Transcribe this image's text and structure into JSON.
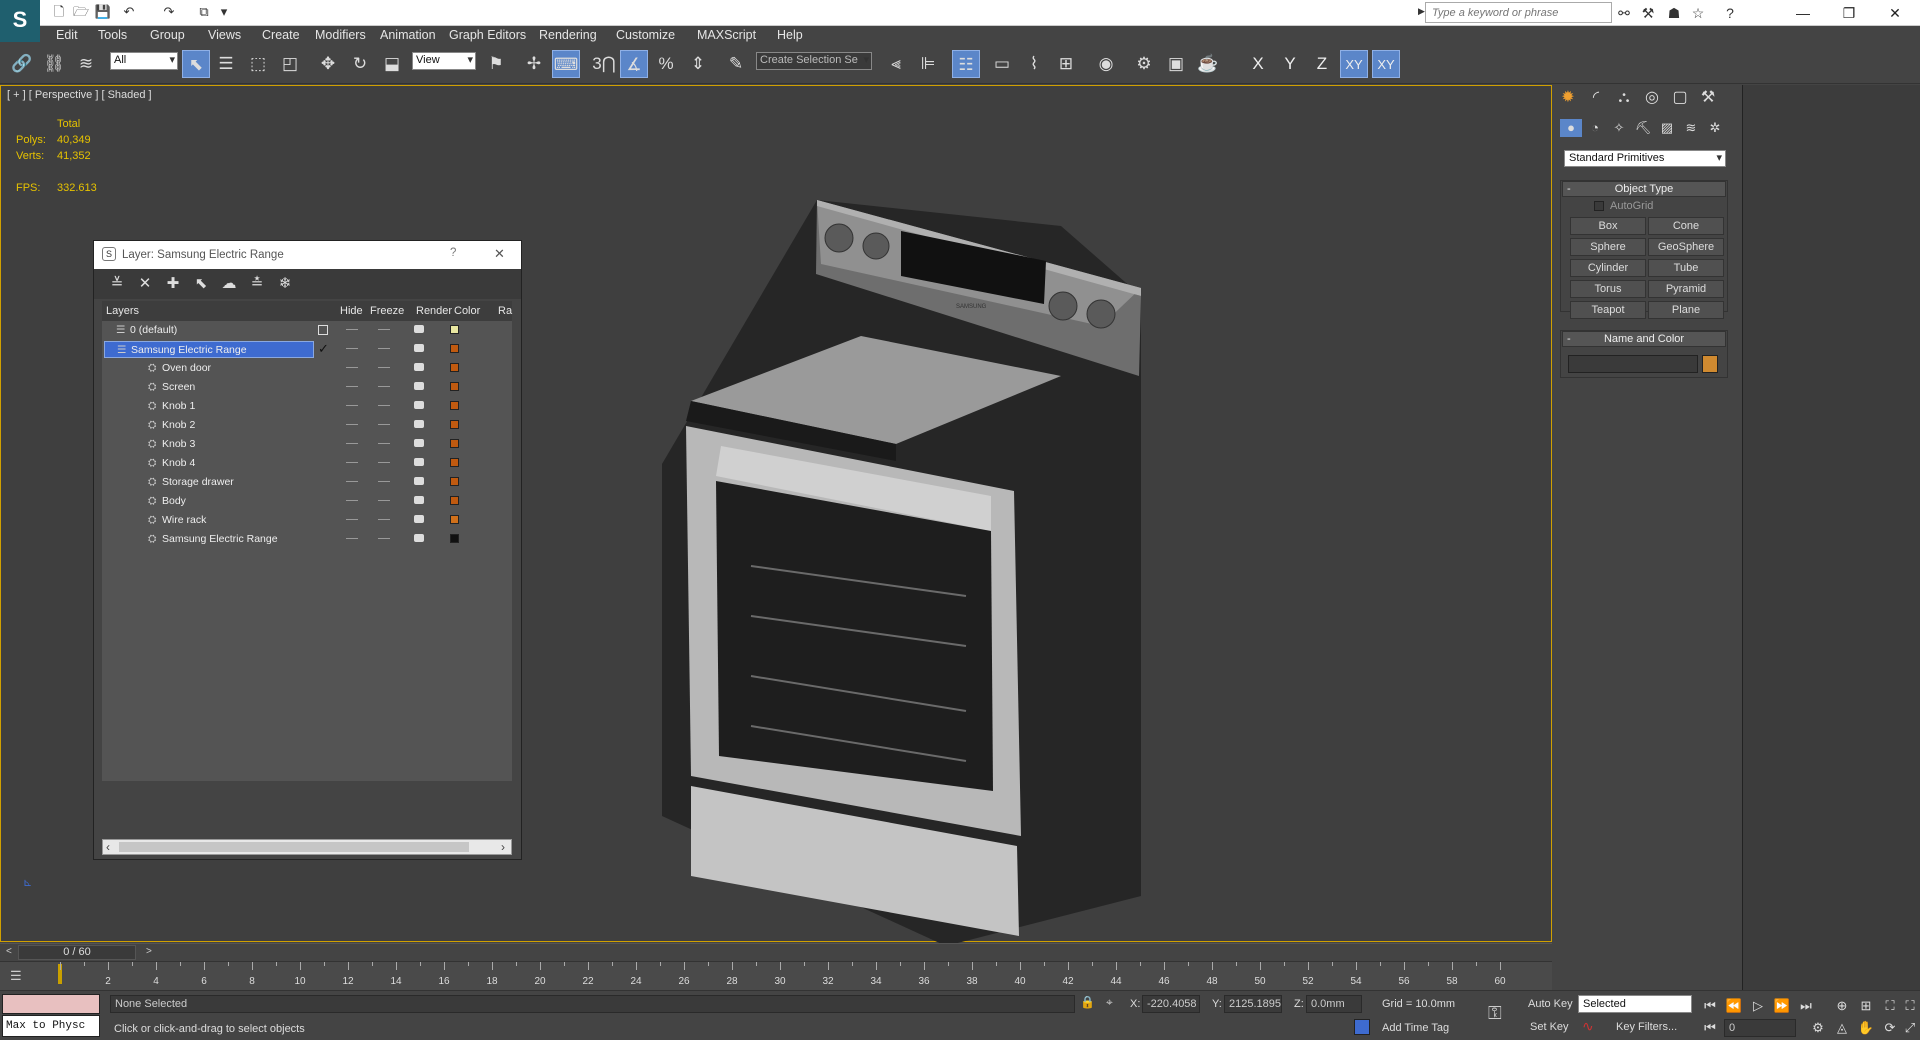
{
  "app": {
    "logo_letter": "S"
  },
  "search": {
    "placeholder": "Type a keyword or phrase"
  },
  "menu": [
    "Edit",
    "Tools",
    "Group",
    "Views",
    "Create",
    "Modifiers",
    "Animation",
    "Graph Editors",
    "Rendering",
    "Customize",
    "MAXScript",
    "Help"
  ],
  "toolbar": {
    "selection_filter": "All",
    "ref_coord": "View",
    "snap_num": "3",
    "selection_set": "Create Selection Se",
    "axis_x": "X",
    "axis_y": "Y",
    "axis_z": "Z",
    "axis_xy": "XY",
    "axis_xy2": "XY"
  },
  "viewport": {
    "label": "[ + ] [ Perspective ] [ Shaded ]",
    "stats": {
      "total_label": "Total",
      "polys_label": "Polys:",
      "polys": "40,349",
      "verts_label": "Verts:",
      "verts": "41,352",
      "fps_label": "FPS:",
      "fps": "332.613"
    },
    "brand": "SAMSUNG"
  },
  "layer_window": {
    "title": "Layer: Samsung Electric Range",
    "help": "?",
    "close": "✕",
    "columns": [
      "Layers",
      "Hide",
      "Freeze",
      "Render",
      "Color",
      "Ra"
    ],
    "rows": [
      {
        "name": "0 (default)",
        "indent": 1,
        "color": "#e8e6a0",
        "selected": false,
        "current_box": true
      },
      {
        "name": "Samsung Electric Range",
        "indent": 1,
        "color": "#c05a10",
        "selected": true,
        "check": "✓"
      },
      {
        "name": "Oven door",
        "indent": 2,
        "color": "#c05a10"
      },
      {
        "name": "Screen",
        "indent": 2,
        "color": "#c05a10"
      },
      {
        "name": "Knob 1",
        "indent": 2,
        "color": "#c05a10"
      },
      {
        "name": "Knob 2",
        "indent": 2,
        "color": "#c05a10"
      },
      {
        "name": "Knob 3",
        "indent": 2,
        "color": "#c05a10"
      },
      {
        "name": "Knob 4",
        "indent": 2,
        "color": "#c05a10"
      },
      {
        "name": "Storage drawer",
        "indent": 2,
        "color": "#c05a10"
      },
      {
        "name": "Body",
        "indent": 2,
        "color": "#c05a10"
      },
      {
        "name": "Wire rack",
        "indent": 2,
        "color": "#d0701a"
      },
      {
        "name": "Samsung Electric Range",
        "indent": 2,
        "color": "#111111"
      }
    ]
  },
  "command_panel": {
    "category": "Standard Primitives",
    "object_type_label": "Object Type",
    "autogrid": "AutoGrid",
    "buttons": [
      "Box",
      "Cone",
      "Sphere",
      "GeoSphere",
      "Cylinder",
      "Tube",
      "Torus",
      "Pyramid",
      "Teapot",
      "Plane"
    ],
    "name_color_label": "Name and Color",
    "swatch_color": "#d08a30"
  },
  "timeline": {
    "frame": "0 / 60",
    "ticks": [
      "2",
      "4",
      "6",
      "8",
      "10",
      "12",
      "14",
      "16",
      "18",
      "20",
      "22",
      "24",
      "26",
      "28",
      "30",
      "32",
      "34",
      "36",
      "38",
      "40",
      "42",
      "44",
      "46",
      "48",
      "50",
      "52",
      "54",
      "56",
      "58",
      "60"
    ]
  },
  "status": {
    "script_listener": "Max to Physc",
    "selection": "None Selected",
    "prompt": "Click or click-and-drag to select objects",
    "x_label": "X:",
    "x": "-220.4058",
    "y_label": "Y:",
    "y": "2125.1895",
    "z_label": "Z:",
    "z": "0.0mm",
    "grid": "Grid = 10.0mm",
    "add_time_tag": "Add Time Tag",
    "auto_key": "Auto Key",
    "set_key": "Set Key",
    "key_mode": "Selected",
    "key_filters": "Key Filters...",
    "current_frame": "0"
  },
  "colors": {
    "accent": "#5b86c9",
    "selection_blue": "#3e6bd0",
    "viewport_border": "#d0a000"
  }
}
